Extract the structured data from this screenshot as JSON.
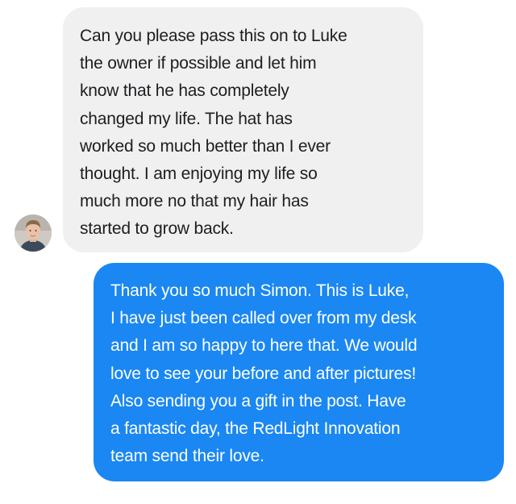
{
  "conversation": {
    "messages": [
      {
        "sender": "contact",
        "text": "Can you please pass this on to Luke\nthe owner if possible and let him\nknow that he has completely\nchanged my life. The hat has\nworked so much better than I ever\nthought. I am enjoying my life so\nmuch more no that my hair has\nstarted to grow back."
      },
      {
        "sender": "self",
        "text": "Thank you so much Simon. This is Luke,\nI have just been called over from my desk\nand I am so happy to here that. We would\nlove to see your before and after pictures!\nAlso sending you a gift in the post. Have\na fantastic day, the RedLight Innovation\nteam send their love."
      }
    ],
    "colors": {
      "incoming_bubble": "#f0f0f0",
      "incoming_text": "#1c1e21",
      "outgoing_bubble": "#1a87f2",
      "outgoing_text": "#ffffff"
    }
  }
}
